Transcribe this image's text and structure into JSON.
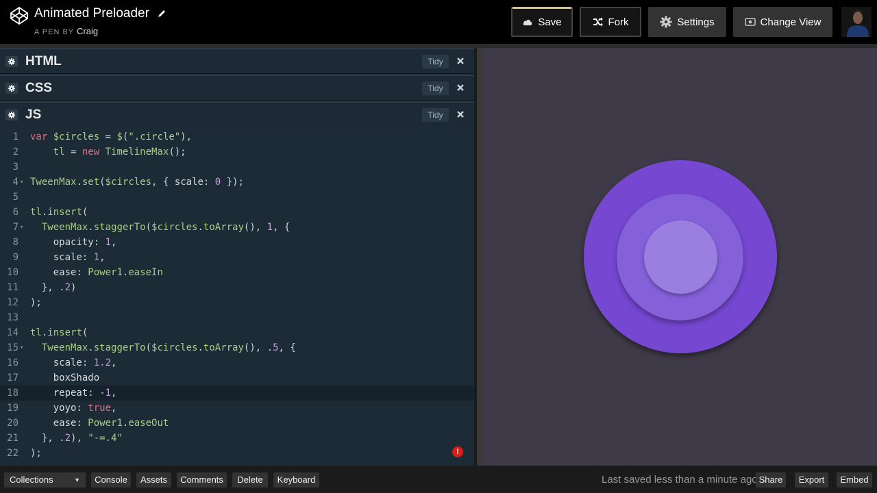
{
  "header": {
    "title": "Animated Preloader",
    "byline_prefix": "A PEN BY",
    "author": "Craig",
    "buttons": {
      "save": "Save",
      "fork": "Fork",
      "settings": "Settings",
      "change_view": "Change View"
    }
  },
  "editors": {
    "panels": [
      {
        "name": "HTML",
        "tidy": "Tidy"
      },
      {
        "name": "CSS",
        "tidy": "Tidy"
      },
      {
        "name": "JS",
        "tidy": "Tidy"
      }
    ],
    "js_code": [
      {
        "n": "1",
        "text": "var $circles = $(\".circle\"),"
      },
      {
        "n": "2",
        "text": "    tl = new TimelineMax();"
      },
      {
        "n": "3",
        "text": ""
      },
      {
        "n": "4",
        "text": "TweenMax.set($circles, { scale: 0 });"
      },
      {
        "n": "5",
        "text": ""
      },
      {
        "n": "6",
        "text": "tl.insert("
      },
      {
        "n": "7",
        "text": "  TweenMax.staggerTo($circles.toArray(), 1, {"
      },
      {
        "n": "8",
        "text": "    opacity: 1,"
      },
      {
        "n": "9",
        "text": "    scale: 1,"
      },
      {
        "n": "10",
        "text": "    ease: Power1.easeIn"
      },
      {
        "n": "11",
        "text": "  }, .2)"
      },
      {
        "n": "12",
        "text": ");"
      },
      {
        "n": "13",
        "text": ""
      },
      {
        "n": "14",
        "text": "tl.insert("
      },
      {
        "n": "15",
        "text": "  TweenMax.staggerTo($circles.toArray(), .5, {"
      },
      {
        "n": "16",
        "text": "    scale: 1.2,"
      },
      {
        "n": "17",
        "text": "    boxShado"
      },
      {
        "n": "18",
        "text": "    repeat: -1,"
      },
      {
        "n": "19",
        "text": "    yoyo: true,"
      },
      {
        "n": "20",
        "text": "    ease: Power1.easeOut"
      },
      {
        "n": "21",
        "text": "  }, .2), \"-=.4\""
      },
      {
        "n": "22",
        "text": ");"
      }
    ],
    "error_marker": "!"
  },
  "footer": {
    "collections": "Collections",
    "console": "Console",
    "assets": "Assets",
    "comments": "Comments",
    "delete": "Delete",
    "keyboard": "Keyboard",
    "status": "Last saved less than a minute ago",
    "share": "Share",
    "export": "Export",
    "embed": "Embed"
  },
  "colors": {
    "outer_circle": "#7648d2",
    "middle_circle": "#8460d9",
    "inner_circle": "#9a7fe0",
    "preview_bg": "#3f3a47",
    "editor_bg": "#1d2b36"
  },
  "icons": {
    "logo": "codepen-logo-icon",
    "edit": "pencil-icon",
    "save": "cloud-icon",
    "fork": "fork-icon",
    "settings": "gear-icon",
    "change_view": "eye-icon",
    "panel_settings": "gear-icon",
    "panel_close": "close-icon",
    "collections": "caret-down-icon"
  }
}
